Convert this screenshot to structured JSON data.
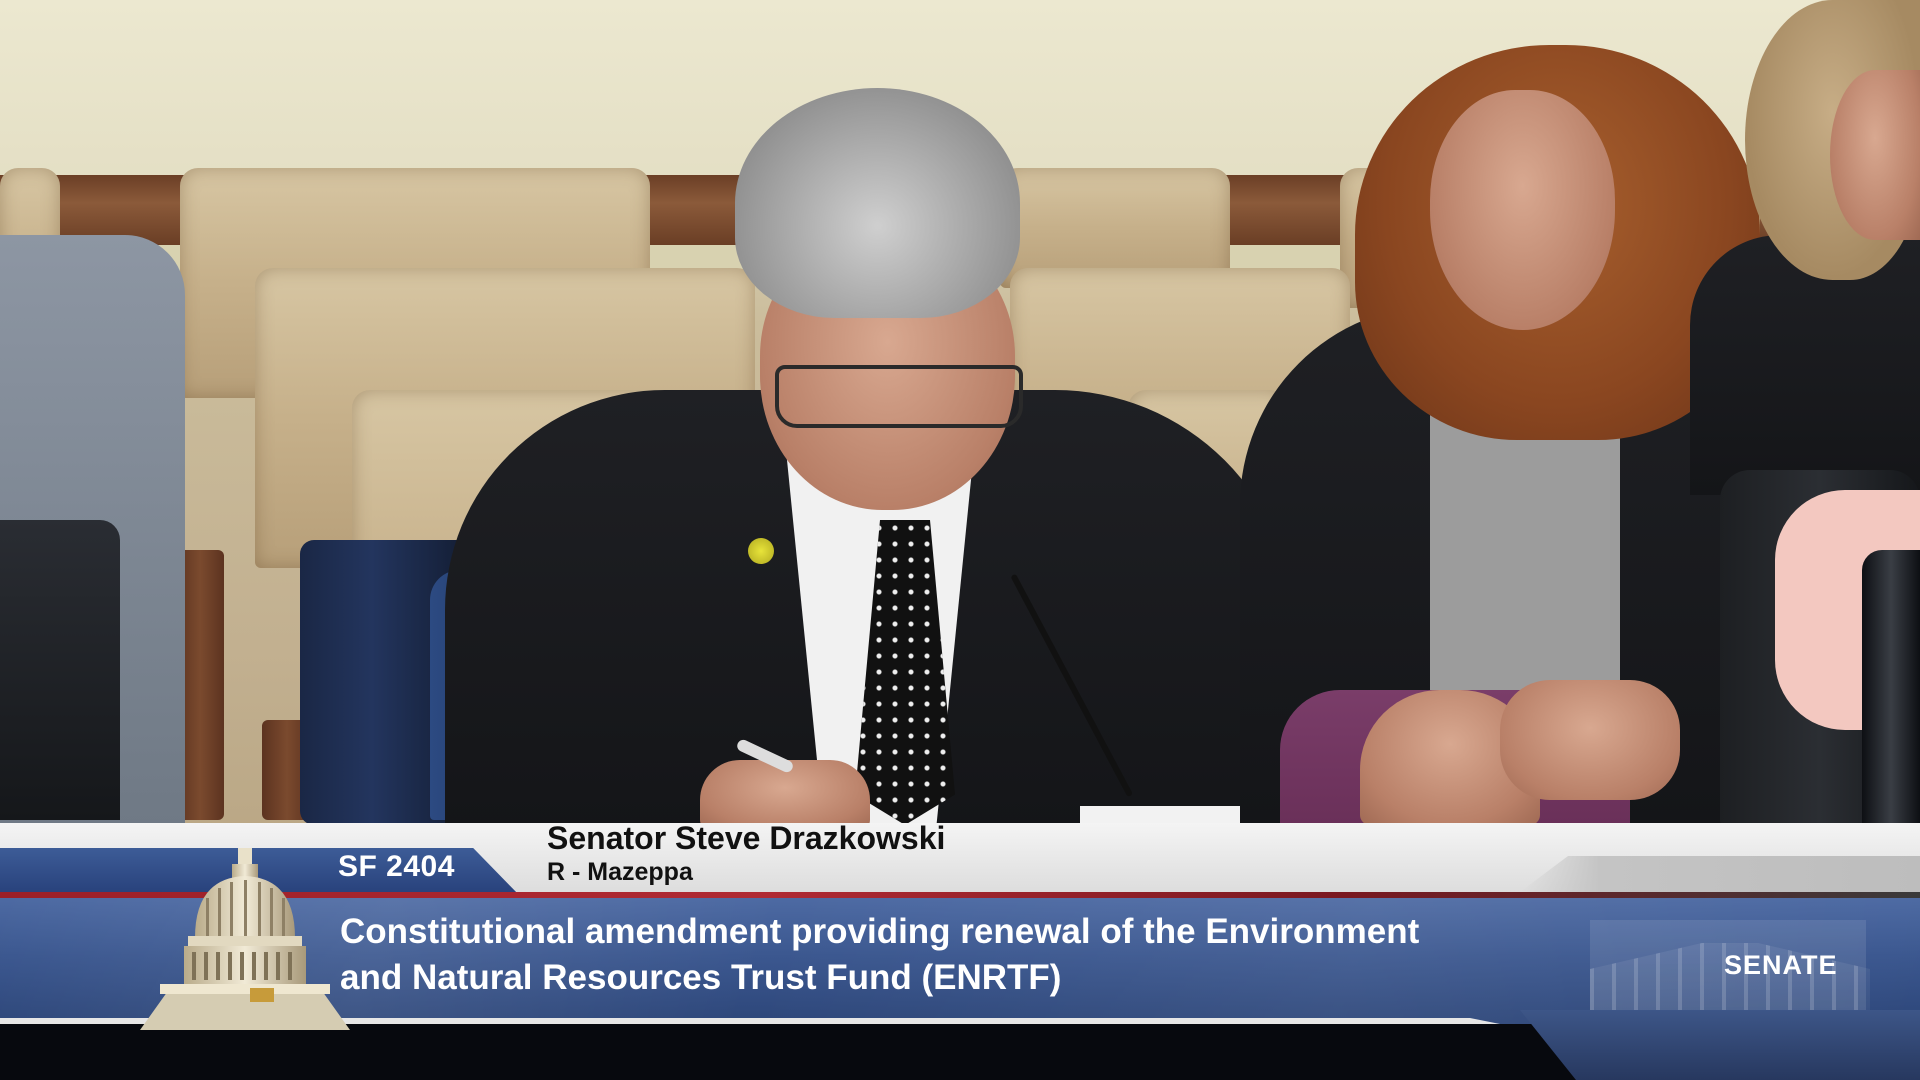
{
  "lower_third": {
    "bill_number": "SF 2404",
    "speaker_name": "Senator Steve Drazkowski",
    "speaker_affiliation": "R - Mazeppa",
    "bill_title_line1": "Constitutional amendment providing renewal of the Environment",
    "bill_title_line2": "and Natural Resources Trust Fund (ENRTF)",
    "chamber_label": "SENATE"
  },
  "colors": {
    "banner_blue": "#3b578f",
    "accent_red": "#9b1f28",
    "name_bar": "#e8e8e8"
  },
  "icons": {
    "capitol": "capitol-dome-icon",
    "senate_building": "senate-building-icon"
  }
}
